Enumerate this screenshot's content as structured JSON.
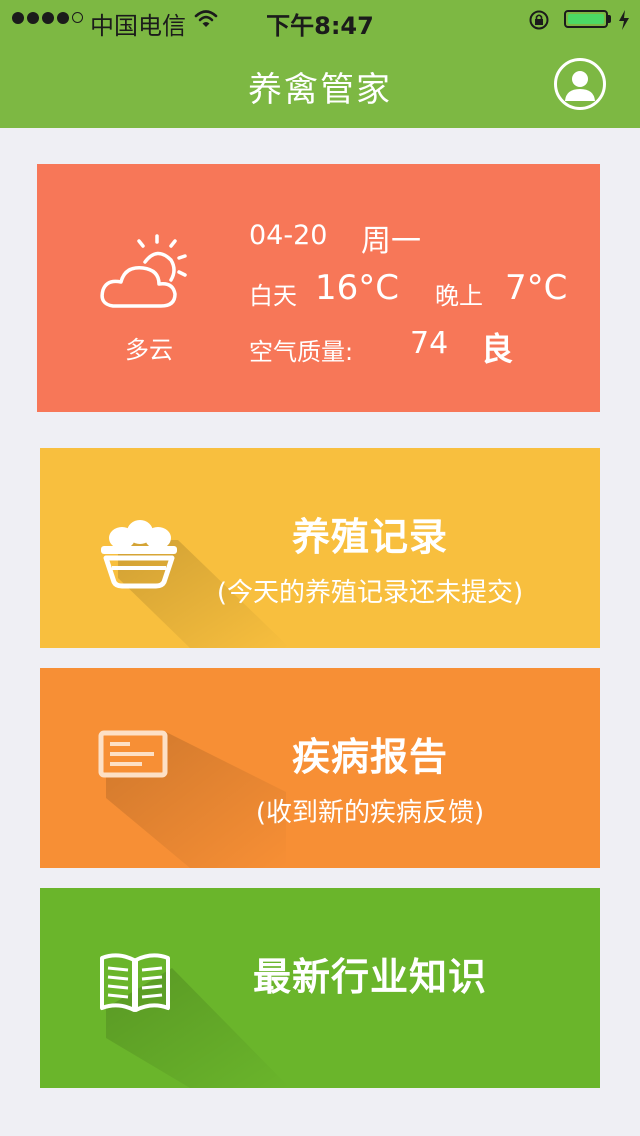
{
  "status_bar": {
    "carrier": "中国电信",
    "time": "下午8:47",
    "signal_bars_filled": 4,
    "signal_bars_total": 5,
    "battery_level": 1.0,
    "icons": [
      "wifi-icon",
      "rotation-lock-icon",
      "battery-icon",
      "charging-icon"
    ]
  },
  "header": {
    "title": "养禽管家",
    "profile_icon": "user-profile-icon",
    "background_color": "#7db843"
  },
  "weather": {
    "icon": "partly-cloudy-icon",
    "condition": "多云",
    "date": "04-20",
    "weekday": "周一",
    "day_label": "白天",
    "day_temp": "16°C",
    "night_label": "晚上",
    "night_temp": "7°C",
    "air_quality_label": "空气质量:",
    "air_quality_value": "74",
    "air_quality_level": "良",
    "background_color": "#f77758"
  },
  "tiles": [
    {
      "title": "养殖记录",
      "subtitle": "(今天的养殖记录还未提交)",
      "icon": "egg-basket-icon",
      "color": "#f8bf3e"
    },
    {
      "title": "疾病报告",
      "subtitle": "(收到新的疾病反馈)",
      "icon": "report-document-icon",
      "color": "#f78f35"
    },
    {
      "title": "最新行业知识",
      "subtitle": "",
      "icon": "open-book-icon",
      "color": "#6ab52b"
    }
  ]
}
